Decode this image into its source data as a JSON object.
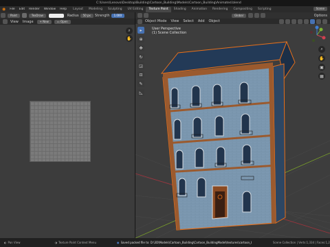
{
  "titlebar": {
    "path": "C:\\Users\\Lenovo\\Desktop\\Building\\Cartoon_Building\\Models\\Cartoon_Building\\Animated.blend"
  },
  "menu": [
    "File",
    "Edit",
    "Render",
    "Window",
    "Help"
  ],
  "workspaces": [
    "Layout",
    "Modeling",
    "Sculpting",
    "UV Editing",
    "Texture Paint",
    "Shading",
    "Animation",
    "Rendering",
    "Compositing",
    "Scripting"
  ],
  "workspace_active": "Texture Paint",
  "scene": {
    "label": "Scene",
    "viewlayer": "ViewLayer"
  },
  "uv_editor": {
    "mode": "Paint",
    "brush": "TexDraw",
    "radius_label": "Radius",
    "radius_value": "50 px",
    "strength_label": "Strength",
    "strength_value": "1.000",
    "view_menu": "View",
    "image_menu": "Image",
    "new_btn": "New",
    "open_btn": "Open"
  },
  "viewport": {
    "mode": "Object Mode",
    "menus": [
      "View",
      "Select",
      "Add",
      "Object"
    ],
    "overlay_title": "User Perspective",
    "overlay_collection": "(1) Scene Collection",
    "orientation": "Global",
    "options": "Options"
  },
  "status": {
    "left": "Pan View",
    "middle": "Texture Paint Context Menu",
    "message": "Saved packed file to: D:\\3D\\Models\\Cartoon_Building\\Cartoon_BuildingModel\\textures\\cartoon_building.jpg",
    "right": "Scene Collection | Verts:1,334 | Faces:1,2"
  },
  "colors": {
    "accent": "#4772b3",
    "wall": "#7a95ad",
    "trim": "#9b5a2e",
    "roof": "#1f3550",
    "selection_outline": "#e8701a"
  }
}
